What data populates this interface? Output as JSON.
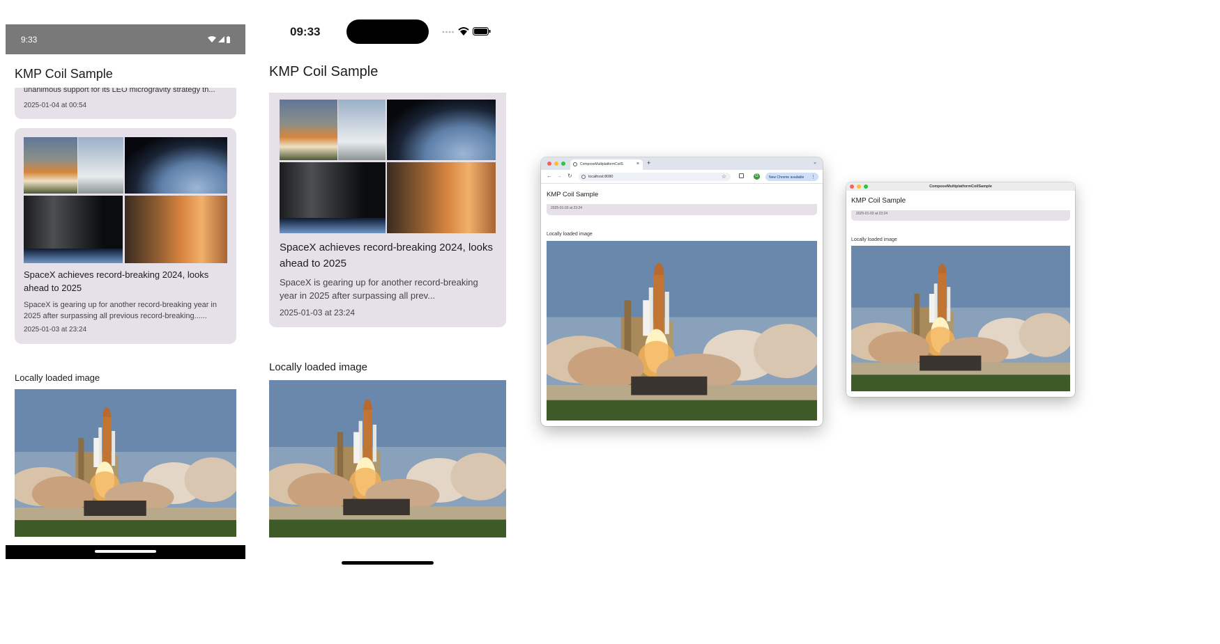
{
  "colors": {
    "card_bg": "#e6e0e9",
    "android_status_bg": "#797979",
    "chrome_tabstrip": "#dee3ec",
    "close": "#ff5f57",
    "minimize": "#febc2e",
    "maximize": "#28c840"
  },
  "android": {
    "status_time": "9:33",
    "app_title": "KMP Coil Sample",
    "prev_card": {
      "excerpt": "unanimous support for its LEO microgravity strategy th...",
      "date": "2025-01-04 at 00:54"
    },
    "card": {
      "title": "SpaceX achieves record-breaking 2024, looks ahead to 2025",
      "summary": "SpaceX is gearing up for another record-breaking year in 2025 after surpassing all previous record-breaking......",
      "date": "2025-01-03 at 23:24"
    },
    "local_heading": "Locally loaded image"
  },
  "ios": {
    "status_time": "09:33",
    "app_title": "KMP Coil Sample",
    "card": {
      "title": "SpaceX achieves record-breaking 2024, looks ahead to 2025",
      "summary": "SpaceX is gearing up for another record-breaking year in 2025 after surpassing all prev...",
      "date": "2025-01-03 at 23:24"
    },
    "local_heading": "Locally loaded image"
  },
  "web": {
    "tab_title": "ComposeMultiplatformCoilS",
    "url": "localhost:8080",
    "update_chip": "New Chrome available",
    "profile_initial": "G",
    "app_title": "KMP Coil Sample",
    "card_date": "2025-01-03 at 23:24",
    "local_heading": "Locally loaded image"
  },
  "desktop": {
    "window_title": "ComposeMultiplatformCoilSample",
    "app_title": "KMP Coil Sample",
    "card_date": "2025-01-03 at 23:24",
    "local_heading": "Locally loaded image"
  }
}
